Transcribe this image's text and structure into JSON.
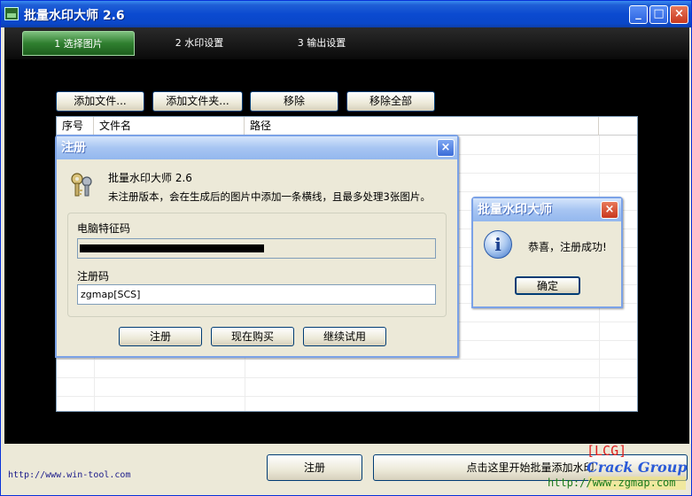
{
  "window": {
    "title": "批量水印大师 2.6",
    "min": "_",
    "max": "□",
    "close": "×"
  },
  "tabs": [
    {
      "label": "1 选择图片"
    },
    {
      "label": "2 水印设置"
    },
    {
      "label": "3 输出设置"
    }
  ],
  "toolbar": {
    "add_file": "添加文件...",
    "add_folder": "添加文件夹...",
    "remove": "移除",
    "remove_all": "移除全部"
  },
  "list": {
    "columns": [
      "序号",
      "文件名",
      "路径"
    ]
  },
  "bottom": {
    "url": "http://www.win-tool.com",
    "register_button": "注册",
    "start_button": "点击这里开始批量添加水印"
  },
  "reg_dialog": {
    "title": "注册",
    "close": "×",
    "app_name": "批量水印大师 2.6",
    "notice": "未注册版本，会在生成后的图片中添加一条横线，且最多处理3张图片。",
    "machine_code_label": "电脑特征码",
    "reg_code_label": "注册码",
    "reg_code_value": "zgmap[SCS]",
    "register": "注册",
    "buy_now": "现在购买",
    "continue_trial": "继续试用"
  },
  "msg_dialog": {
    "title": "批量水印大师",
    "close": "×",
    "icon": "i",
    "message": "恭喜，注册成功!",
    "ok": "确定"
  },
  "watermark": {
    "lcg": "[LCG]",
    "group": "Crack Group",
    "url": "http://www.zgmap.com"
  }
}
